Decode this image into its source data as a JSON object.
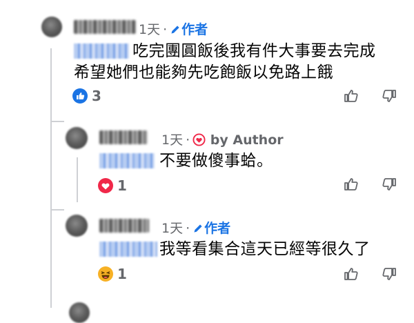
{
  "comments": [
    {
      "time": "1天",
      "separator": "·",
      "badge": "作者",
      "line1": "吃完團圓飯後我有件大事要去完成",
      "line2": "希望她們也能夠先吃飽飯以免路上餓",
      "reaction_icon": "like-icon",
      "reaction_count": "3"
    },
    {
      "time": "1天",
      "separator": "·",
      "badge": "by Author",
      "line1": "不要做傻事蛤。",
      "reaction_icon": "love-icon",
      "reaction_count": "1"
    },
    {
      "time": "1天",
      "separator": "·",
      "badge": "作者",
      "line1": "我等看集合這天已經等很久了",
      "reaction_icon": "haha-icon",
      "reaction_count": "1"
    }
  ],
  "colors": {
    "badge_blue": "#1b74e4",
    "meta_gray": "#65676b",
    "thread_line": "#ced0d4",
    "love_red": "#f02849"
  }
}
